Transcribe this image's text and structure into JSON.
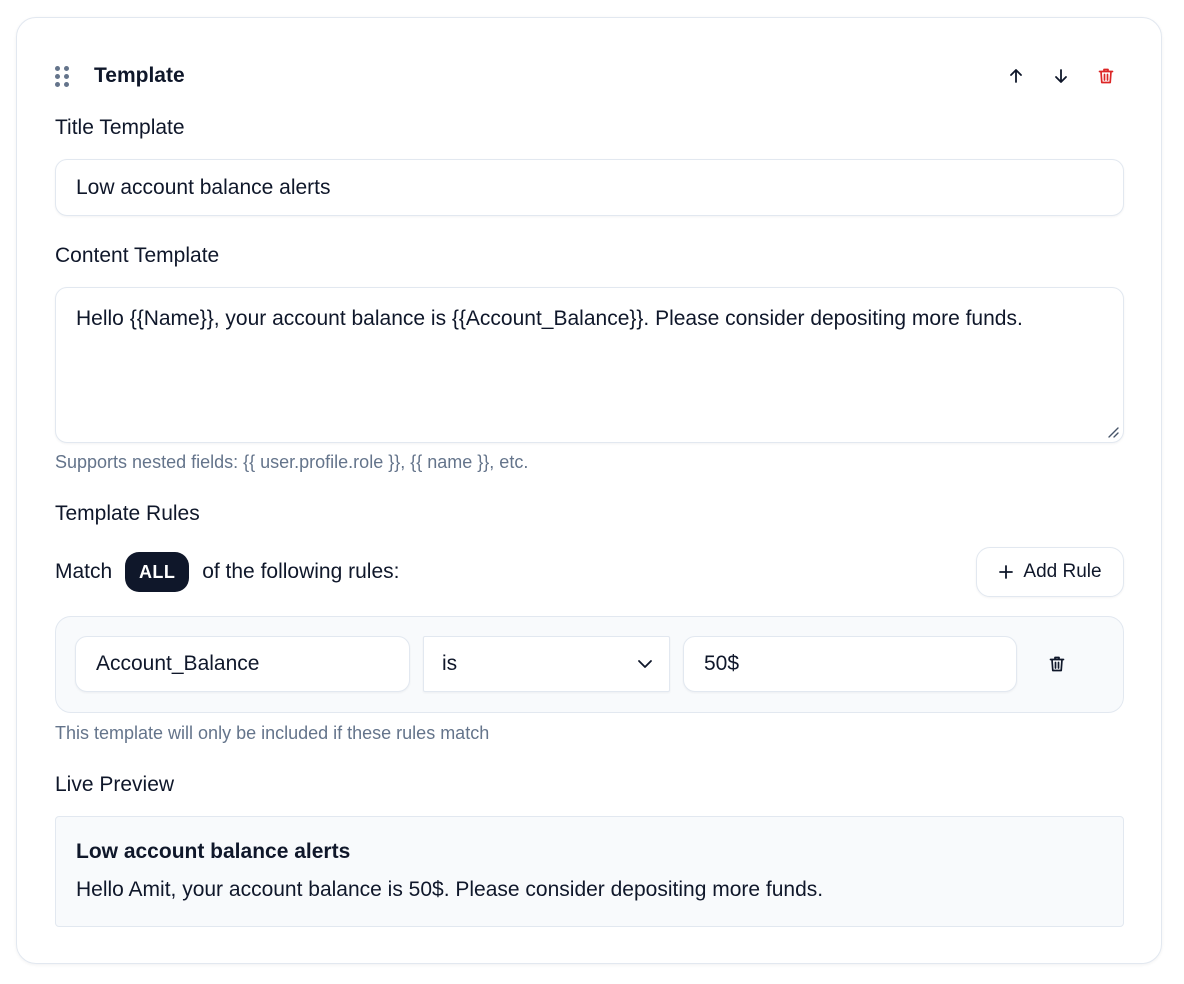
{
  "header": {
    "title": "Template"
  },
  "title_template": {
    "label": "Title Template",
    "value": "Low account balance alerts"
  },
  "content_template": {
    "label": "Content Template",
    "value": "Hello {{Name}}, your account balance is {{Account_Balance}}. Please consider depositing more funds.",
    "hint": "Supports nested fields: {{ user.profile.role }}, {{ name }}, etc."
  },
  "rules": {
    "label": "Template Rules",
    "match_prefix": "Match",
    "match_mode": "ALL",
    "match_suffix": "of the following rules:",
    "add_rule_label": "Add Rule",
    "items": [
      {
        "field": "Account_Balance",
        "operator": "is",
        "value": "50$"
      }
    ],
    "hint": "This template will only be included if these rules match"
  },
  "preview": {
    "label": "Live Preview",
    "title": "Low account balance alerts",
    "body": "Hello Amit, your account balance is 50$. Please consider depositing more funds."
  },
  "colors": {
    "accent": "#0f172a",
    "danger": "#dc2626",
    "muted": "#64748b",
    "border": "#e2e8f0"
  },
  "icons": [
    "drag-handle-icon",
    "arrow-up-icon",
    "arrow-down-icon",
    "trash-icon",
    "plus-icon",
    "chevron-down-icon"
  ]
}
